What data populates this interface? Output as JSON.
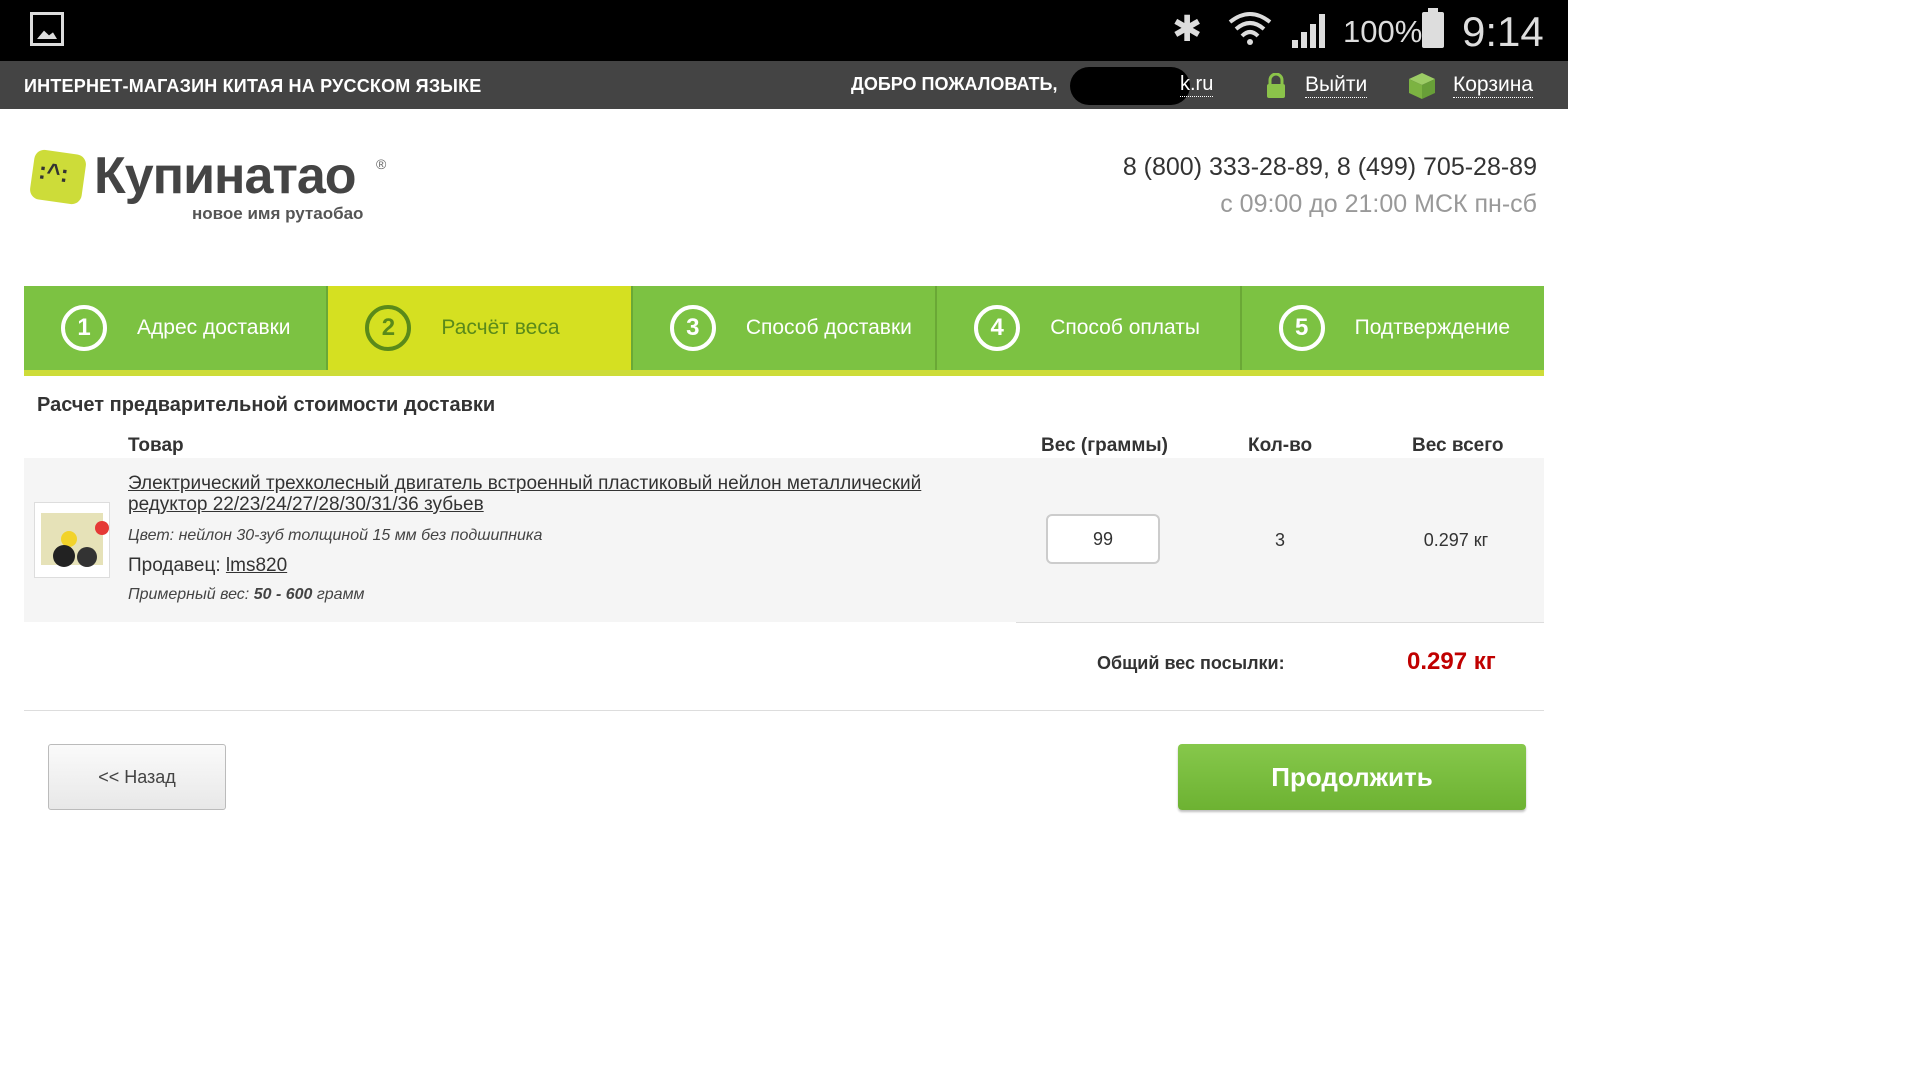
{
  "status_bar": {
    "battery": "100%",
    "time": "9:14",
    "icons": [
      "gallery-icon",
      "bluetooth-icon",
      "wifi-icon",
      "signal-icon",
      "battery-icon"
    ]
  },
  "top_nav": {
    "shop_title": "ИНТЕРНЕТ-МАГАЗИН КИТАЯ НА РУССКОМ ЯЗЫКЕ",
    "welcome": "ДОБРО ПОЖАЛОВАТЬ,",
    "email_visible": "k.ru",
    "logout": "Выйти",
    "cart": "Корзина"
  },
  "logo": {
    "brand": "Купинатао",
    "registered": "®",
    "tagline": "новое имя рутаобао"
  },
  "contact": {
    "phones": "8 (800) 333-28-89, 8 (499) 705-28-89",
    "hours": "с 09:00 до 21:00 МСК пн-сб"
  },
  "steps": [
    {
      "num": "1",
      "label": "Адрес доставки",
      "active": false
    },
    {
      "num": "2",
      "label": "Расчёт веса",
      "active": true
    },
    {
      "num": "3",
      "label": "Способ доставки",
      "active": false
    },
    {
      "num": "4",
      "label": "Способ оплаты",
      "active": false
    },
    {
      "num": "5",
      "label": "Подтверждение",
      "active": false
    }
  ],
  "section_title": "Расчет предварительной стоимости доставки",
  "table": {
    "headers": {
      "product": "Товар",
      "weight": "Вес (граммы)",
      "qty": "Кол-во",
      "total": "Вес всего"
    },
    "rows": [
      {
        "title": "Электрический трехколесный двигатель встроенный пластиковый нейлон металлический редуктор 22/23/24/27/28/30/31/36 зубьев",
        "color": "Цвет: нейлон 30-зуб толщиной 15 мм без подшипника",
        "seller_label": "Продавец:",
        "seller": "lms820",
        "approx_label": "Примерный вес:",
        "approx_value": "50 - 600",
        "approx_unit": "грамм",
        "weight": "99",
        "qty": "3",
        "total": "0.297 кг"
      }
    ]
  },
  "summary": {
    "label": "Общий вес посылки:",
    "value": "0.297 кг"
  },
  "buttons": {
    "back": "<< Назад",
    "continue": "Продолжить"
  },
  "colors": {
    "green": "#7cc242",
    "active_step": "#d5e021",
    "accent_red": "#c00000",
    "nav_bg": "#444444"
  }
}
